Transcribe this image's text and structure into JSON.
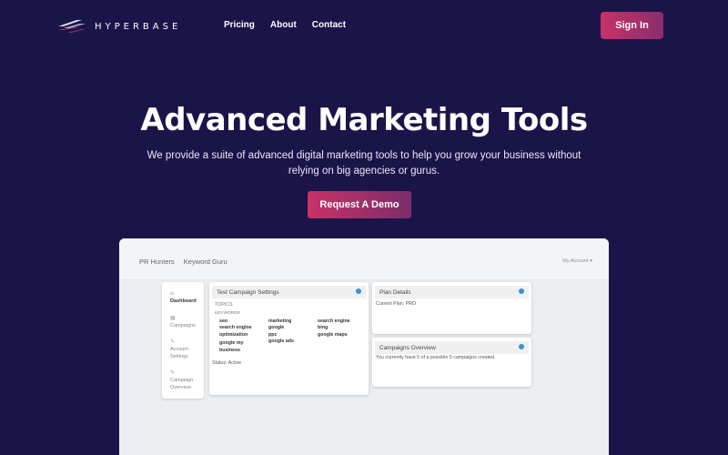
{
  "brand": {
    "name": "HYPERBASE",
    "accent": "#c73266",
    "bg": "#1b1449"
  },
  "nav": {
    "items": [
      "Pricing",
      "About",
      "Contact"
    ]
  },
  "signin_label": "Sign In",
  "hero": {
    "title": "Advanced Marketing Tools",
    "subtitle": "We provide a suite of advanced digital marketing tools to help you grow your business without relying on big agencies or gurus.",
    "cta": "Request A Demo"
  },
  "app": {
    "top_links": [
      "PR Hunters",
      "Keyword Guru"
    ],
    "account": "My Account ▾",
    "sidebar": [
      {
        "label": "Dashboard",
        "icon": "home-icon",
        "glyph": "⌂"
      },
      {
        "label": "Campaigns",
        "icon": "grid-icon",
        "glyph": "▦"
      },
      {
        "label": "Account Settings",
        "icon": "pencil-icon",
        "glyph": "✎"
      },
      {
        "label": "Campaign Overview",
        "icon": "pencil-icon",
        "glyph": "✎"
      }
    ],
    "campaign_card": {
      "title": "Test Campaign Settings",
      "topics_label": "TOPICS",
      "keywords_label": "KEYWORDS",
      "keywords": [
        [
          "seo",
          "search engine optimization",
          "google my business"
        ],
        [
          "marketing",
          "google",
          "ppc",
          "google ads"
        ],
        [
          "search engine",
          "bing",
          "google maps"
        ]
      ],
      "status": "Status: Active"
    },
    "plan_card": {
      "title": "Plan Details",
      "text": "Current Plan: PRO"
    },
    "overview_card": {
      "title": "Campaigns Overview",
      "text": "You currently have 5 of a possible 5 campaigns created."
    }
  }
}
